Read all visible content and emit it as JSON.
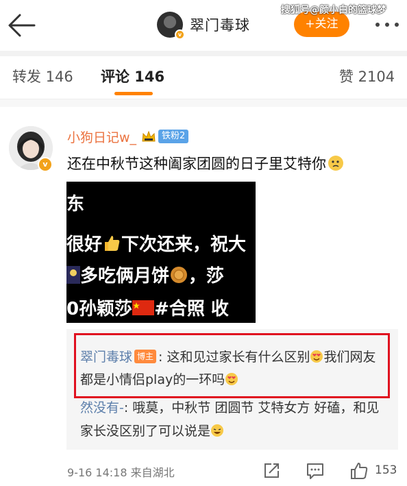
{
  "nav": {
    "author_name": "翠门毒球",
    "follow_label": "+关注",
    "watermark": "搜狐号@颜小白的篮球梦",
    "icons": [
      "back-arrow-icon",
      "more-icon"
    ]
  },
  "tabs": {
    "repost": "转发 146",
    "comment": "评论 146",
    "like": "赞 2104"
  },
  "comment": {
    "username": "小狗日记w_",
    "fan_badge": "铁粉2",
    "text": "还在中秋节这种阖家团圆的日子里艾特你",
    "image_lines": [
      "东",
      "很好",
      "下次还来，祝大",
      "多吃俩月饼",
      "，莎",
      "0孙颖莎",
      "#合照  收"
    ],
    "colors": {
      "username": "#eb7340",
      "fan_badge": "#5aa3e8",
      "accent": "#ff8200",
      "highlight_border": "#e0101f"
    }
  },
  "replies": {
    "reply1_name": "翠门毒球",
    "reply1_badge": "博主",
    "reply1_text": ": 这和见过家长有什么区别",
    "reply1_text2": "我们网友都是小情侣play的一环吗",
    "reply2_name": "然没有-",
    "reply2_text": ": 哦莫，中秋节 团圆节 艾特女方 好磕，和见家长没区别了可以说是"
  },
  "footer": {
    "meta": "9-16 14:18  来自湖北",
    "like_count": "153"
  }
}
